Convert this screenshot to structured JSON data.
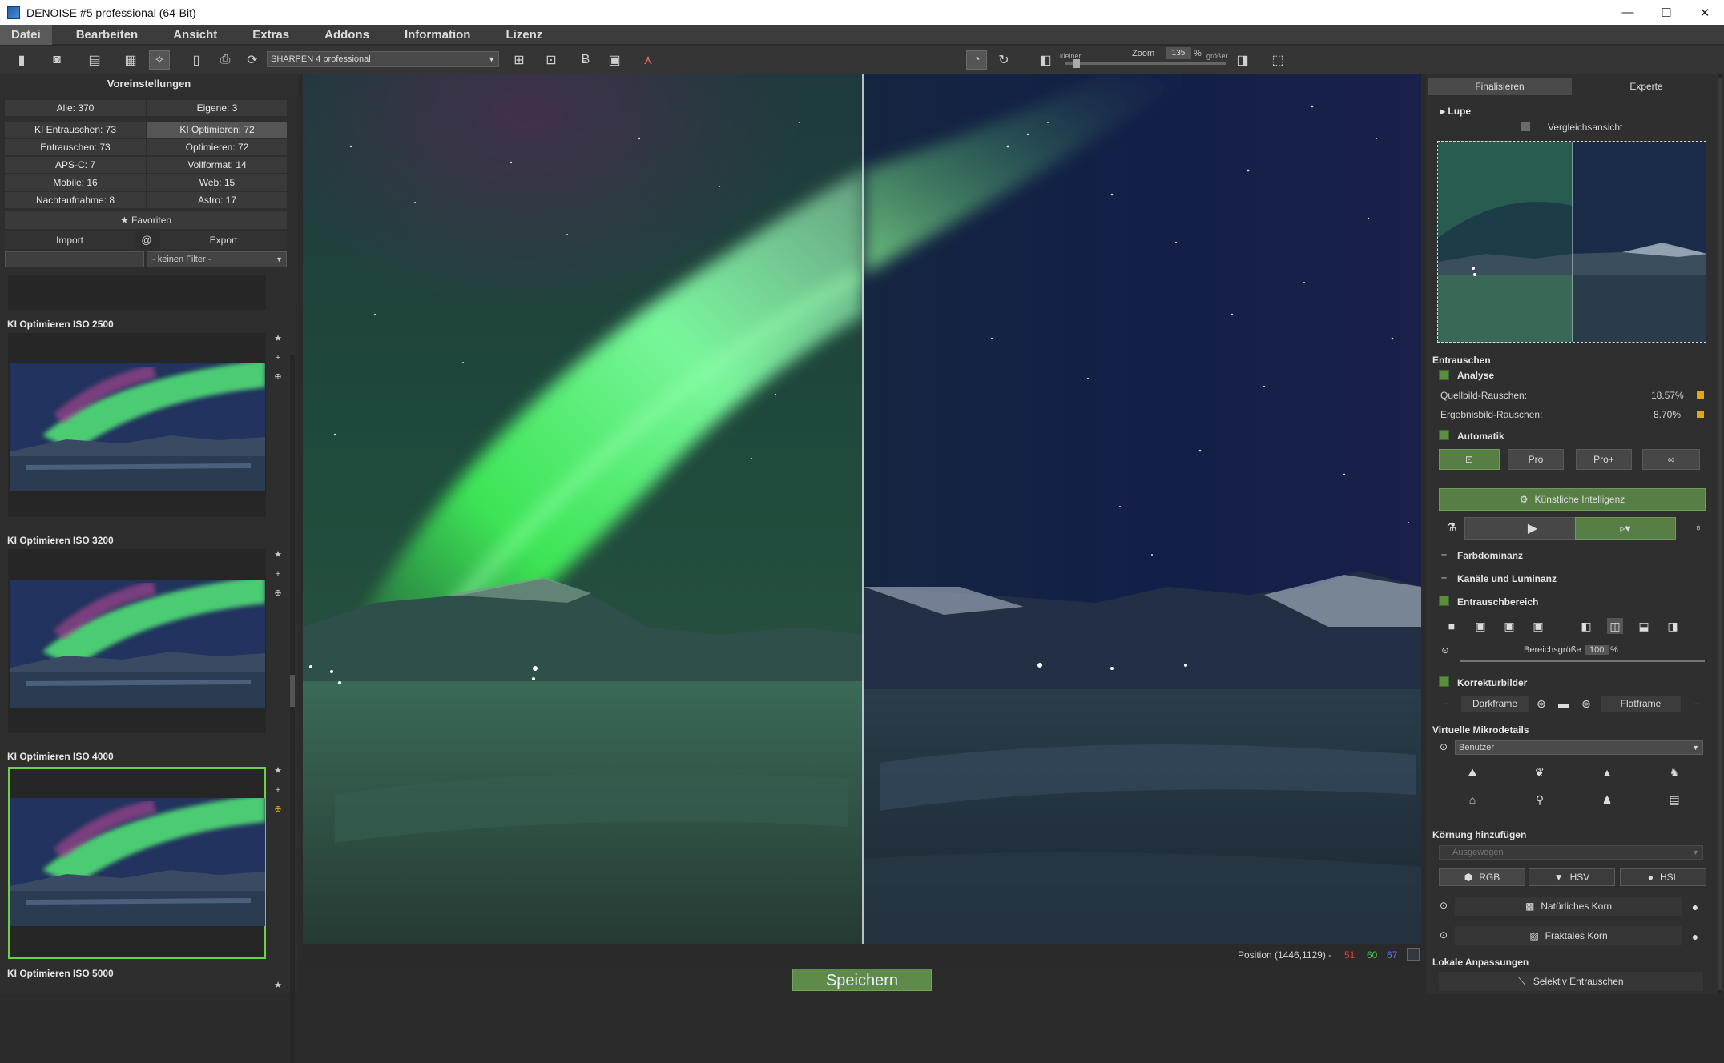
{
  "window": {
    "title": "DENOISE #5 professional (64-Bit)",
    "minimize": "—",
    "maximize": "☐",
    "close": "✕"
  },
  "menu": [
    "Datei",
    "Bearbeiten",
    "Ansicht",
    "Extras",
    "Addons",
    "Information",
    "Lizenz"
  ],
  "toolbar": {
    "preset": "SHARPEN 4 professional",
    "zoom_label": "Zoom",
    "zoom_value": "135",
    "zoom_unit": "%",
    "smaller": "kleiner",
    "larger": "größer"
  },
  "presets_panel": {
    "title": "Voreinstellungen",
    "stats": [
      [
        "Alle: 370",
        "Eigene: 3"
      ],
      [
        "KI Entrauschen: 73",
        "KI Optimieren: 72"
      ],
      [
        "Entrauschen: 73",
        "Optimieren: 72"
      ],
      [
        "APS-C: 7",
        "Vollformat: 14"
      ],
      [
        "Mobile: 16",
        "Web: 15"
      ],
      [
        "Nachtaufnahme: 8",
        "Astro: 17"
      ]
    ],
    "favorites": "★ Favoriten",
    "import": "Import",
    "at": "@",
    "export": "Export",
    "filter": "- keinen Filter -",
    "items": [
      {
        "title": "KI Optimieren ISO 2500"
      },
      {
        "title": "KI Optimieren ISO 3200"
      },
      {
        "title": "KI Optimieren ISO 4000"
      },
      {
        "title": "KI Optimieren ISO 5000"
      }
    ]
  },
  "status": {
    "position": "Position  (1446,1129)  -",
    "r": "51",
    "g": "60",
    "b": "67",
    "r_color": "#e04040",
    "g_color": "#4fc04f",
    "b_color": "#5a7ae8"
  },
  "save_button": "Speichern",
  "right_panel": {
    "tabs": [
      "Finalisieren",
      "Experte"
    ],
    "lupe": "Lupe",
    "compare": "Vergleichsansicht",
    "entrauschen": "Entrauschen",
    "analyse": "Analyse",
    "source_noise_label": "Quellbild-Rauschen:",
    "source_noise_value": "18.57%",
    "result_noise_label": "Ergebnisbild-Rauschen:",
    "result_noise_value": "8.70%",
    "automatik": "Automatik",
    "auto_modes": [
      "Pro",
      "Pro",
      "Pro+",
      "∞"
    ],
    "ki_button": "Künstliche Intelligenz",
    "farbdominanz": "Farbdominanz",
    "kanaele": "Kanäle und Luminanz",
    "entrauschbereich": "Entrauschbereich",
    "bereichsgroesse_label": "Bereichsgröße",
    "bereichsgroesse_value": "100",
    "bereichsgroesse_unit": "%",
    "korrekturbilder": "Korrekturbilder",
    "darkframe": "Darkframe",
    "flatframe": "Flatframe",
    "mikrodetails": "Virtuelle Mikrodetails",
    "benutzer": "Benutzer",
    "koernung": "Körnung hinzufügen",
    "ausgewogen": "Ausgewogen",
    "color_modes": [
      "RGB",
      "HSV",
      "HSL"
    ],
    "natuerlich": "Natürliches Korn",
    "fraktal": "Fraktales Korn",
    "lokale": "Lokale Anpassungen",
    "selektiv": "Selektiv Entrauschen"
  }
}
